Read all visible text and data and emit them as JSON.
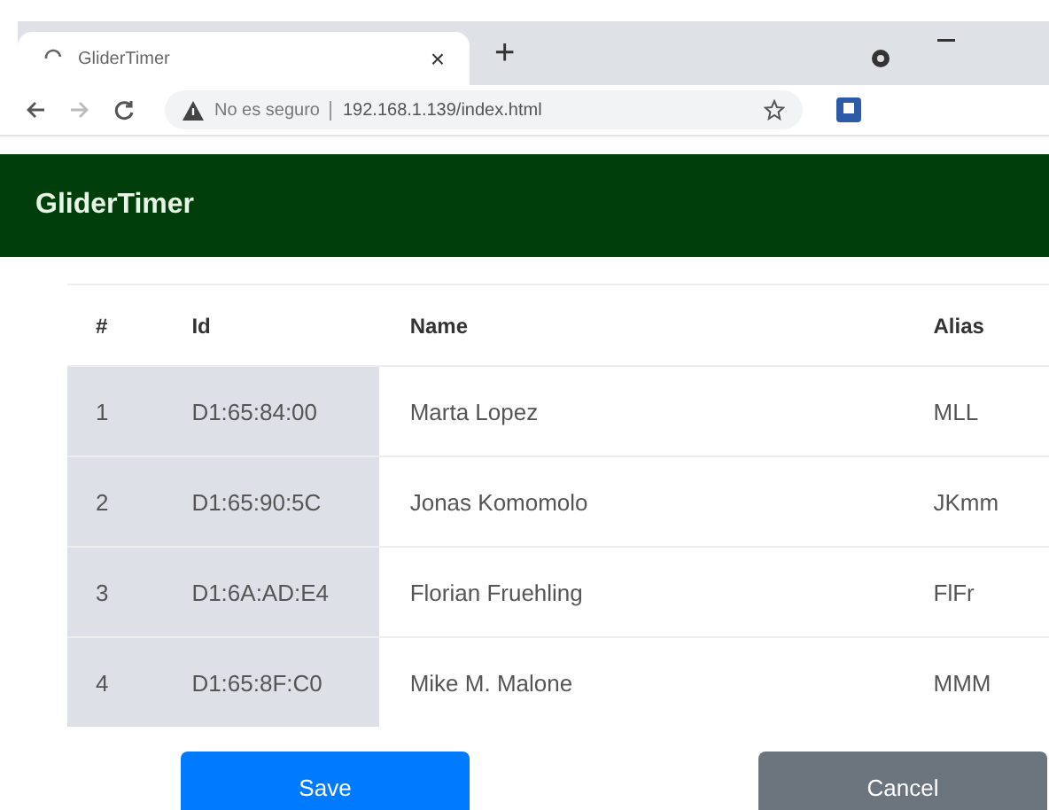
{
  "browser": {
    "tab_title": "GliderTimer",
    "tab_close": "×",
    "new_tab": "+",
    "security_label": "No es seguro",
    "url": "192.168.1.139/index.html"
  },
  "header": {
    "title": "GliderTimer"
  },
  "table": {
    "columns": [
      "#",
      "Id",
      "Name",
      "Alias"
    ],
    "rows": [
      {
        "number": "1",
        "id": "D1:65:84:00",
        "name": "Marta Lopez",
        "alias": "MLL"
      },
      {
        "number": "2",
        "id": "D1:65:90:5C",
        "name": "Jonas Komomolo",
        "alias": "JKmm"
      },
      {
        "number": "3",
        "id": "D1:6A:AD:E4",
        "name": "Florian Fruehling",
        "alias": "FlFr"
      },
      {
        "number": "4",
        "id": "D1:65:8F:C0",
        "name": "Mike M. Malone",
        "alias": "MMM"
      }
    ]
  },
  "buttons": [
    {
      "kind": "primary",
      "label": "Save"
    },
    {
      "kind": "secondary",
      "label": "Cancel"
    }
  ]
}
